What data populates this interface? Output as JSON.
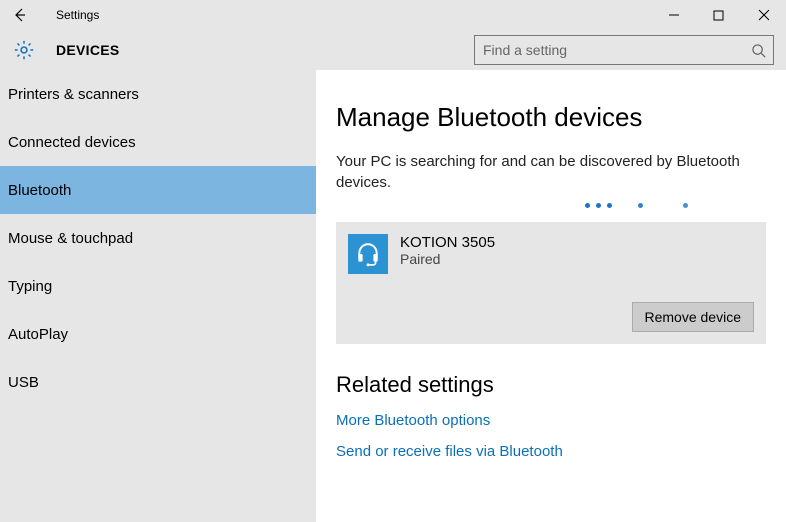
{
  "window": {
    "app_title": "Settings"
  },
  "header": {
    "section": "DEVICES"
  },
  "search": {
    "placeholder": "Find a setting"
  },
  "sidebar": {
    "items": [
      {
        "label": "Printers & scanners",
        "selected": false
      },
      {
        "label": "Connected devices",
        "selected": false
      },
      {
        "label": "Bluetooth",
        "selected": true
      },
      {
        "label": "Mouse & touchpad",
        "selected": false
      },
      {
        "label": "Typing",
        "selected": false
      },
      {
        "label": "AutoPlay",
        "selected": false
      },
      {
        "label": "USB",
        "selected": false
      }
    ]
  },
  "main": {
    "title": "Manage Bluetooth devices",
    "status_text": "Your PC is searching for and can be discovered by Bluetooth devices.",
    "device": {
      "name": "KOTION 3505",
      "status": "Paired",
      "remove_label": "Remove device"
    },
    "related_heading": "Related settings",
    "links": [
      "More Bluetooth options",
      "Send or receive files via Bluetooth"
    ]
  }
}
